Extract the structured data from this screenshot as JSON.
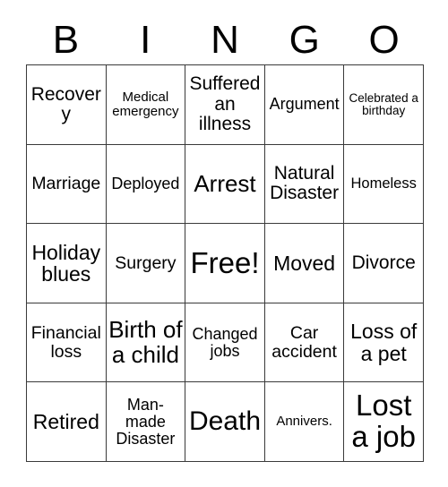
{
  "header": {
    "letters": [
      {
        "label": "B"
      },
      {
        "label": "I"
      },
      {
        "label": "N"
      },
      {
        "label": "G"
      },
      {
        "label": "O"
      }
    ]
  },
  "grid": {
    "columns": 5,
    "rows": 5,
    "free_space_index": 12,
    "border_color": "#3a3a3a",
    "background_color": "#ffffff",
    "text_color": "#000000",
    "cells": [
      {
        "text": "Recovery",
        "size": "fs-21"
      },
      {
        "text": "Medical emergency",
        "size": "fs-15"
      },
      {
        "text": "Suffered an illness",
        "size": "fs-21"
      },
      {
        "text": "Argument",
        "size": "fs-18"
      },
      {
        "text": "Celebrated a birthday",
        "size": "fs-13"
      },
      {
        "text": "Marriage",
        "size": "fs-19"
      },
      {
        "text": "Deployed",
        "size": "fs-18"
      },
      {
        "text": "Arrest",
        "size": "fs-26"
      },
      {
        "text": "Natural Disaster",
        "size": "fs-21"
      },
      {
        "text": "Homeless",
        "size": "fs-16"
      },
      {
        "text": "Holiday blues",
        "size": "fs-23"
      },
      {
        "text": "Surgery",
        "size": "fs-19"
      },
      {
        "text": "Free!",
        "size": "fs-33"
      },
      {
        "text": "Moved",
        "size": "fs-23"
      },
      {
        "text": "Divorce",
        "size": "fs-21"
      },
      {
        "text": "Financial loss",
        "size": "fs-19"
      },
      {
        "text": "Birth of a child",
        "size": "fs-26"
      },
      {
        "text": "Changed jobs",
        "size": "fs-18"
      },
      {
        "text": "Car accident",
        "size": "fs-19"
      },
      {
        "text": "Loss of a pet",
        "size": "fs-23"
      },
      {
        "text": "Retired",
        "size": "fs-23"
      },
      {
        "text": "Man-made Disaster",
        "size": "fs-18"
      },
      {
        "text": "Death",
        "size": "fs-30"
      },
      {
        "text": "Annivers.",
        "size": "fs-15"
      },
      {
        "text": "Lost a job",
        "size": "fs-33"
      }
    ]
  }
}
